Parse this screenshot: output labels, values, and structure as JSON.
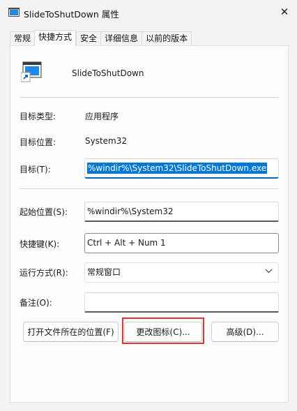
{
  "window": {
    "title": "SlideToShutDown 属性",
    "close_glyph": "✕"
  },
  "tabs": [
    {
      "label": "常规",
      "active": false
    },
    {
      "label": "快捷方式",
      "active": true
    },
    {
      "label": "安全",
      "active": false
    },
    {
      "label": "详细信息",
      "active": false
    },
    {
      "label": "以前的版本",
      "active": false
    }
  ],
  "shortcut": {
    "app_name": "SlideToShutDown",
    "target_type_label": "目标类型:",
    "target_type_value": "应用程序",
    "target_location_label": "目标位置:",
    "target_location_value": "System32",
    "target_label": "目标(T):",
    "target_value": "%windir%\\System32\\SlideToShutDown.exe",
    "start_in_label": "起始位置(S):",
    "start_in_value": "%windir%\\System32",
    "shortcut_key_label": "快捷键(K):",
    "shortcut_key_value": "Ctrl + Alt + Num 1",
    "run_label": "运行方式(R):",
    "run_value": "常规窗口",
    "comment_label": "备注(O):",
    "comment_value": ""
  },
  "buttons": {
    "open_location": "打开文件所在的位置(F)",
    "change_icon": "更改图标(C)...",
    "advanced": "高级(D)..."
  },
  "colors": {
    "selection": "#0078d4",
    "highlight_box": "#e8312f"
  }
}
